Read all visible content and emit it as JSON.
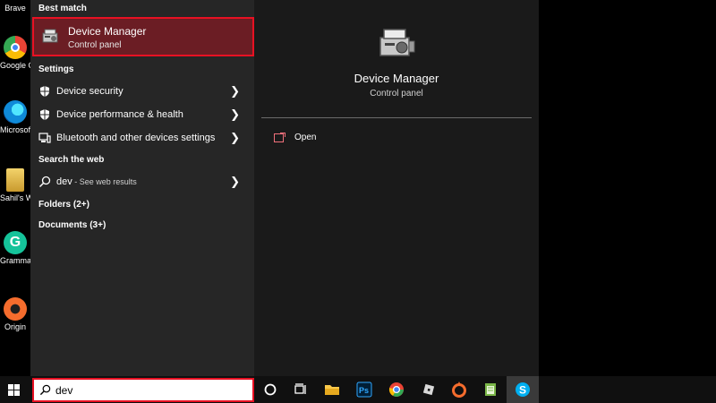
{
  "desktop": {
    "icons": [
      {
        "label": "Brave",
        "color": "#fb542b"
      },
      {
        "label": "Google Chrome",
        "color": "#4285f4"
      },
      {
        "label": "Microsoft Edge",
        "color": "#0f8ad8"
      },
      {
        "label": "Sahil's Wo",
        "color": "#e0c060"
      },
      {
        "label": "Grammarly",
        "color": "#15c39a"
      },
      {
        "label": "Origin",
        "color": "#f56c2d"
      }
    ]
  },
  "search": {
    "best_match_header": "Best match",
    "best_match": {
      "title": "Device Manager",
      "subtitle": "Control panel"
    },
    "settings_header": "Settings",
    "settings_items": [
      {
        "label": "Device security",
        "icon": "shield-icon"
      },
      {
        "label": "Device performance & health",
        "icon": "shield-icon"
      },
      {
        "label": "Bluetooth and other devices settings",
        "icon": "devices-icon"
      }
    ],
    "web_header": "Search the web",
    "web_item": {
      "query": "dev",
      "suffix": " - See web results"
    },
    "folders_label": "Folders (2+)",
    "documents_label": "Documents (3+)"
  },
  "preview": {
    "title": "Device Manager",
    "subtitle": "Control panel",
    "open_label": "Open"
  },
  "taskbar": {
    "search_value": "dev",
    "accent": "#e81123",
    "apps": [
      "cortana-icon",
      "task-view-icon",
      "file-explorer-icon",
      "photoshop-icon",
      "chrome-icon",
      "roblox-icon",
      "origin-icon",
      "notepad-icon",
      "skype-icon"
    ]
  }
}
